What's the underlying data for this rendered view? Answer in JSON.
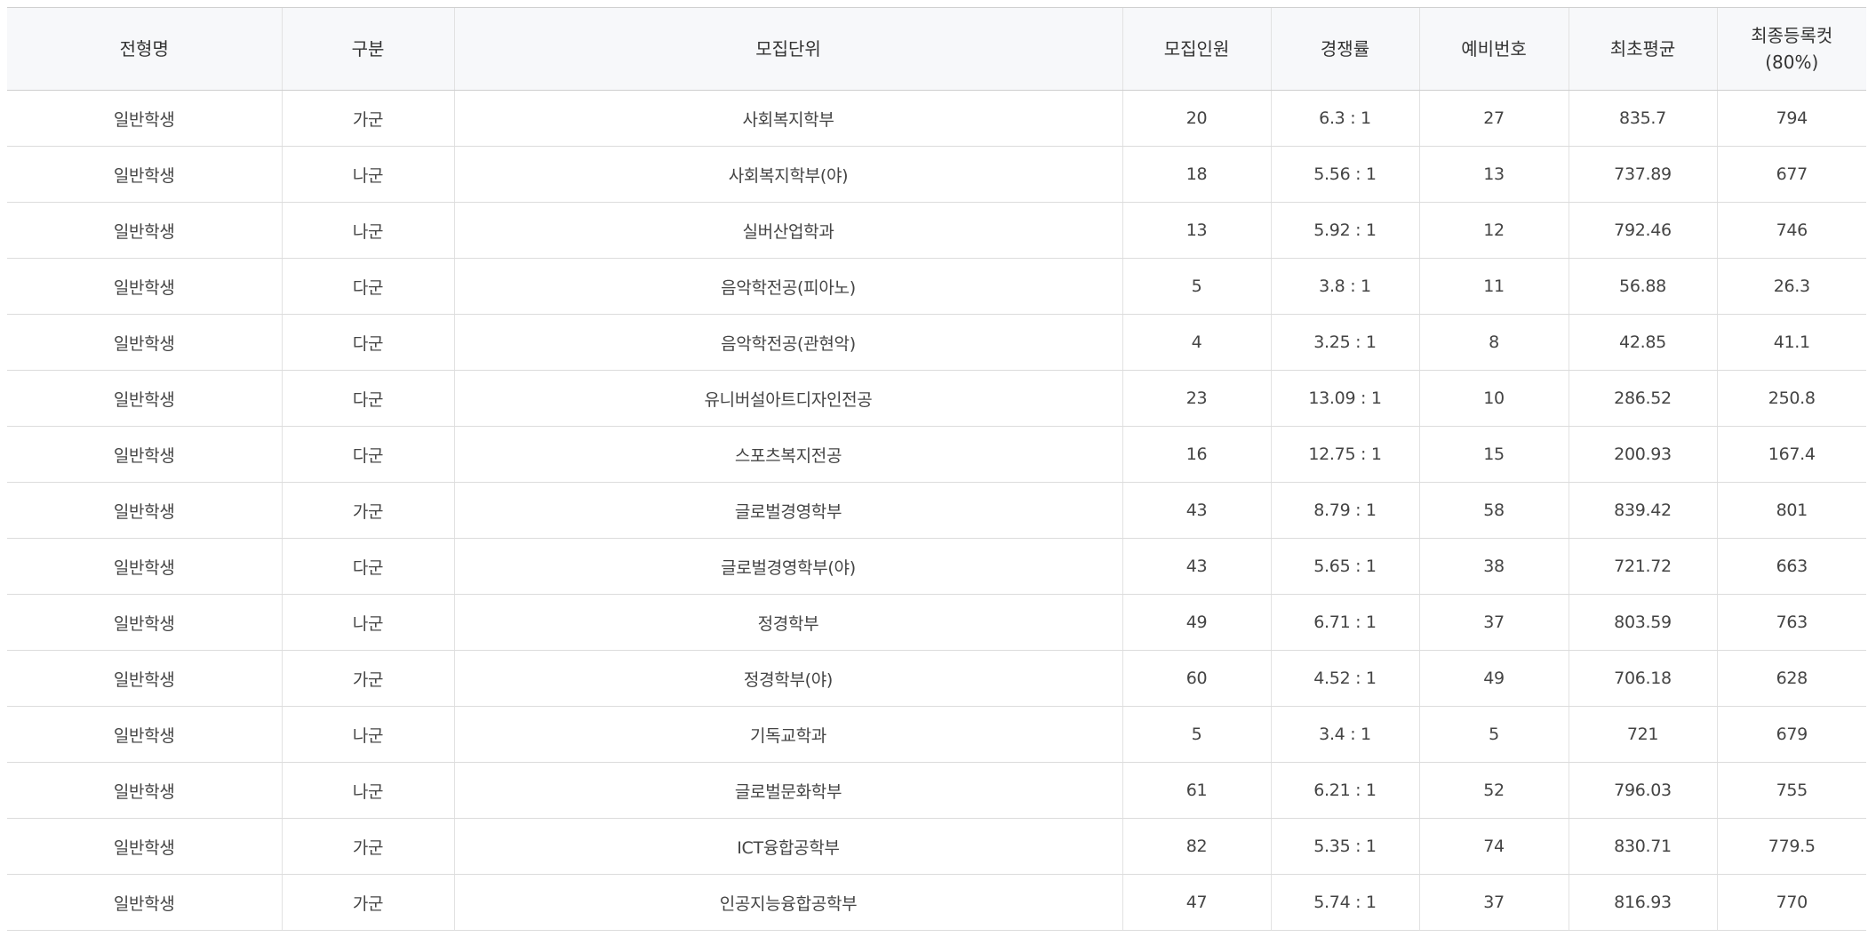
{
  "table": {
    "headers": {
      "type": "전형명",
      "group": "구분",
      "unit": "모집단위",
      "quota": "모집인원",
      "competition": "경쟁률",
      "waitlist": "예비번호",
      "initial_avg": "최초평균",
      "final_cut_line1": "최종등록컷",
      "final_cut_line2": "(80%)"
    },
    "rows": [
      {
        "type": "일반학생",
        "group": "가군",
        "unit": "사회복지학부",
        "quota": "20",
        "competition": "6.3 : 1",
        "waitlist": "27",
        "initial_avg": "835.7",
        "final_cut": "794"
      },
      {
        "type": "일반학생",
        "group": "나군",
        "unit": "사회복지학부(야)",
        "quota": "18",
        "competition": "5.56 : 1",
        "waitlist": "13",
        "initial_avg": "737.89",
        "final_cut": "677"
      },
      {
        "type": "일반학생",
        "group": "나군",
        "unit": "실버산업학과",
        "quota": "13",
        "competition": "5.92 : 1",
        "waitlist": "12",
        "initial_avg": "792.46",
        "final_cut": "746"
      },
      {
        "type": "일반학생",
        "group": "다군",
        "unit": "음악학전공(피아노)",
        "quota": "5",
        "competition": "3.8 : 1",
        "waitlist": "11",
        "initial_avg": "56.88",
        "final_cut": "26.3"
      },
      {
        "type": "일반학생",
        "group": "다군",
        "unit": "음악학전공(관현악)",
        "quota": "4",
        "competition": "3.25 : 1",
        "waitlist": "8",
        "initial_avg": "42.85",
        "final_cut": "41.1"
      },
      {
        "type": "일반학생",
        "group": "다군",
        "unit": "유니버설아트디자인전공",
        "quota": "23",
        "competition": "13.09 : 1",
        "waitlist": "10",
        "initial_avg": "286.52",
        "final_cut": "250.8"
      },
      {
        "type": "일반학생",
        "group": "다군",
        "unit": "스포츠복지전공",
        "quota": "16",
        "competition": "12.75 : 1",
        "waitlist": "15",
        "initial_avg": "200.93",
        "final_cut": "167.4"
      },
      {
        "type": "일반학생",
        "group": "가군",
        "unit": "글로벌경영학부",
        "quota": "43",
        "competition": "8.79 : 1",
        "waitlist": "58",
        "initial_avg": "839.42",
        "final_cut": "801"
      },
      {
        "type": "일반학생",
        "group": "다군",
        "unit": "글로벌경영학부(야)",
        "quota": "43",
        "competition": "5.65 : 1",
        "waitlist": "38",
        "initial_avg": "721.72",
        "final_cut": "663"
      },
      {
        "type": "일반학생",
        "group": "나군",
        "unit": "정경학부",
        "quota": "49",
        "competition": "6.71 : 1",
        "waitlist": "37",
        "initial_avg": "803.59",
        "final_cut": "763"
      },
      {
        "type": "일반학생",
        "group": "가군",
        "unit": "정경학부(야)",
        "quota": "60",
        "competition": "4.52 : 1",
        "waitlist": "49",
        "initial_avg": "706.18",
        "final_cut": "628"
      },
      {
        "type": "일반학생",
        "group": "나군",
        "unit": "기독교학과",
        "quota": "5",
        "competition": "3.4 : 1",
        "waitlist": "5",
        "initial_avg": "721",
        "final_cut": "679"
      },
      {
        "type": "일반학생",
        "group": "나군",
        "unit": "글로벌문화학부",
        "quota": "61",
        "competition": "6.21 : 1",
        "waitlist": "52",
        "initial_avg": "796.03",
        "final_cut": "755"
      },
      {
        "type": "일반학생",
        "group": "가군",
        "unit": "ICT융합공학부",
        "quota": "82",
        "competition": "5.35 : 1",
        "waitlist": "74",
        "initial_avg": "830.71",
        "final_cut": "779.5"
      },
      {
        "type": "일반학생",
        "group": "가군",
        "unit": "인공지능융합공학부",
        "quota": "47",
        "competition": "5.74 : 1",
        "waitlist": "37",
        "initial_avg": "816.93",
        "final_cut": "770"
      }
    ]
  }
}
